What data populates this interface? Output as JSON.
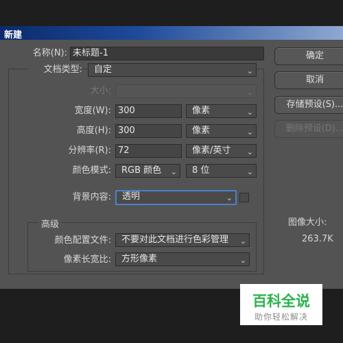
{
  "dialog": {
    "title": "新建"
  },
  "form": {
    "name_label": "名称(N):",
    "name_value": "未标题-1",
    "doctype_label": "文档类型:",
    "doctype_value": "自定",
    "size_label": "大小:",
    "size_value": "",
    "width_label": "宽度(W):",
    "width_value": "300",
    "width_unit": "像素",
    "height_label": "高度(H):",
    "height_value": "300",
    "height_unit": "像素",
    "resolution_label": "分辨率(R):",
    "resolution_value": "72",
    "resolution_unit": "像素/英寸",
    "colormode_label": "颜色模式:",
    "colormode_value": "RGB 颜色",
    "bitdepth_value": "8 位",
    "bg_label": "背景内容:",
    "bg_value": "透明"
  },
  "advanced": {
    "title": "高级",
    "profile_label": "颜色配置文件:",
    "profile_value": "不要对此文档进行色彩管理",
    "aspect_label": "像素长宽比:",
    "aspect_value": "方形像素"
  },
  "buttons": {
    "ok": "确定",
    "cancel": "取消",
    "save_preset": "存储预设(S)...",
    "delete_preset": "删除预设(D)..."
  },
  "image_size": {
    "label": "图像大小:",
    "value": "263.7K"
  },
  "watermark": {
    "brand": "百科全说",
    "sub": "助你轻松解决"
  },
  "icons": {
    "dropdown": "chevron-down-icon"
  }
}
